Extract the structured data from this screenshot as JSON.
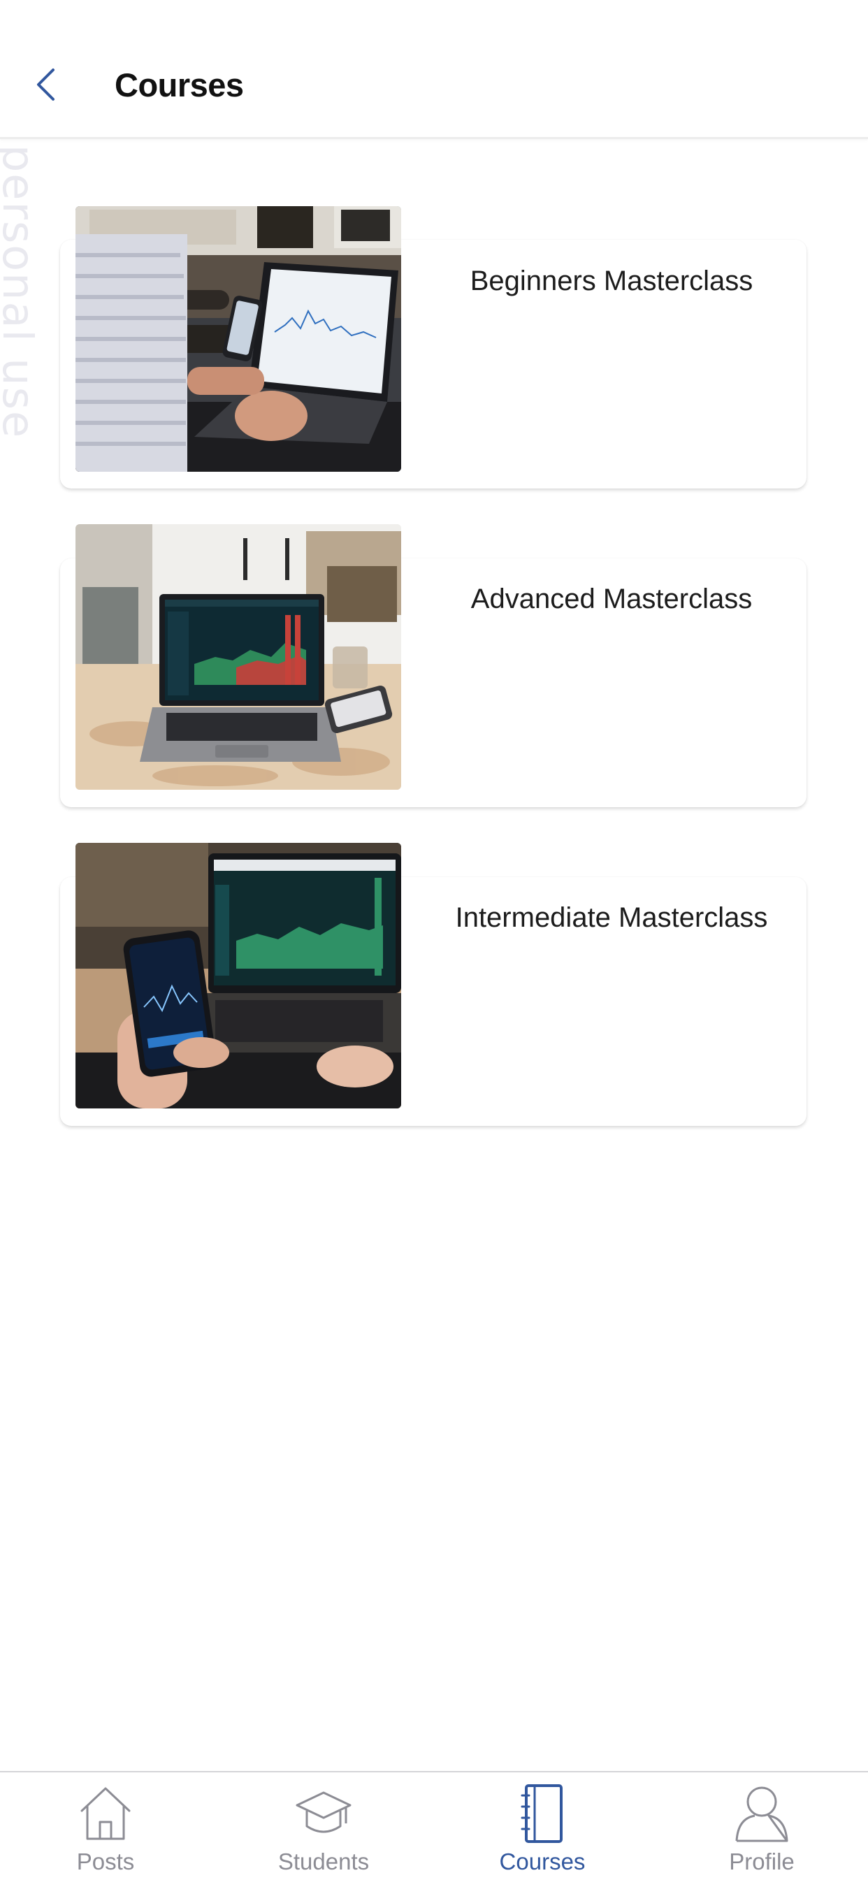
{
  "watermark": "ee for personal use",
  "header": {
    "title": "Courses",
    "back_icon": "chevron-left-icon"
  },
  "courses": [
    {
      "title": "Beginners Masterclass",
      "image": "laptop-and-phone-chart-photo"
    },
    {
      "title": "Advanced Masterclass",
      "image": "laptop-trading-dashboard-photo"
    },
    {
      "title": "Intermediate Masterclass",
      "image": "phone-and-laptop-trading-photo"
    }
  ],
  "tabs": [
    {
      "label": "Posts",
      "icon": "home-icon",
      "active": false
    },
    {
      "label": "Students",
      "icon": "graduation-cap-icon",
      "active": false
    },
    {
      "label": "Courses",
      "icon": "notebook-icon",
      "active": true
    },
    {
      "label": "Profile",
      "icon": "user-icon",
      "active": false
    }
  ],
  "colors": {
    "accent": "#31579e",
    "tab_inactive": "#8c8c94",
    "background": "#ffffff",
    "card_shadow": "#d9d9d9"
  }
}
